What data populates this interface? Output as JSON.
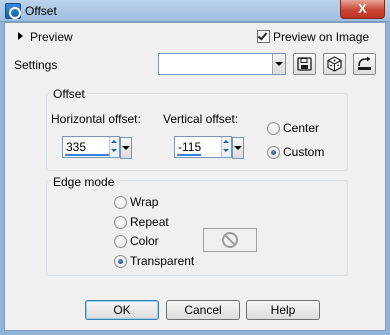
{
  "window": {
    "title": "Offset",
    "close_label": "X"
  },
  "preview": {
    "label": "Preview",
    "preview_on_image_label": "Preview on Image",
    "preview_on_image_checked": true
  },
  "settings": {
    "label": "Settings",
    "value": ""
  },
  "offset": {
    "group_label": "Offset",
    "horizontal_label": "Horizontal offset:",
    "horizontal_value": "335",
    "vertical_label": "Vertical offset:",
    "vertical_value": "-115",
    "center_label": "Center",
    "custom_label": "Custom",
    "selected": "Custom"
  },
  "edge_mode": {
    "group_label": "Edge mode",
    "options": [
      "Wrap",
      "Repeat",
      "Color",
      "Transparent"
    ],
    "selected": "Transparent"
  },
  "buttons": {
    "ok": "OK",
    "cancel": "Cancel",
    "help": "Help"
  },
  "icons": {
    "save": "save-icon",
    "random": "dice-icon",
    "reset": "reset-icon",
    "no_color": "no-color-icon"
  }
}
